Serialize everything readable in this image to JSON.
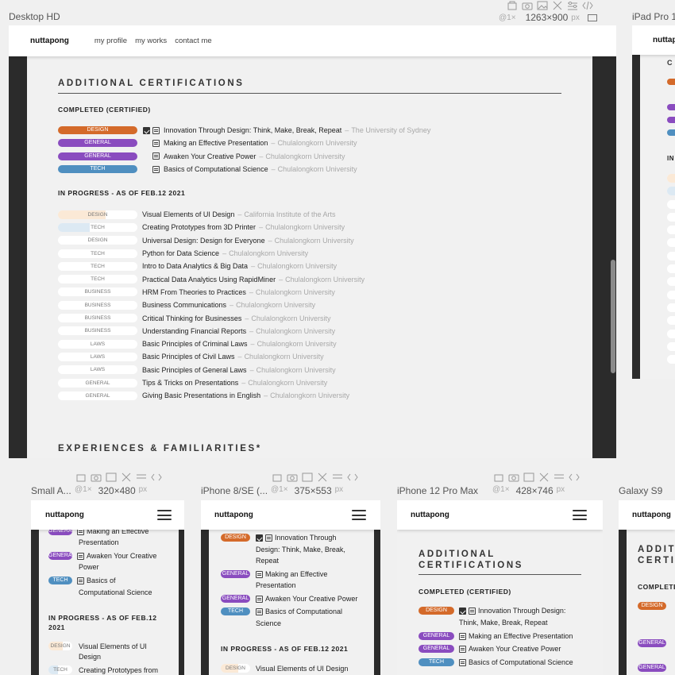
{
  "colors": {
    "design": "#d46a2a",
    "general": "#8a4cbf",
    "tech": "#4f8fc0"
  },
  "frames": {
    "desktop": {
      "title": "Desktop HD",
      "zoom": "@1×",
      "size": "1263×900",
      "unit": "px"
    },
    "ipad": {
      "title": "iPad Pro 1"
    },
    "small": {
      "title": "Small A...",
      "zoom": "@1×",
      "size": "320×480",
      "unit": "px"
    },
    "iphone8": {
      "title": "iPhone 8/SE (...",
      "zoom": "@1×",
      "size": "375×553",
      "unit": "px"
    },
    "iphone12": {
      "title": "iPhone 12 Pro Max",
      "zoom": "@1×",
      "size": "428×746",
      "unit": "px"
    },
    "galaxy": {
      "title": "Galaxy S9"
    }
  },
  "site": {
    "brand": "nuttapong",
    "nav": [
      "my profile",
      "my works",
      "contact me"
    ],
    "section_title": "ADDITIONAL CERTIFICATIONS",
    "section_title_l1": "ADDITIONAL",
    "section_title_l2": "CERTIFICATIONS",
    "section_title_cut": "ADDIT",
    "section_title_cut2": "CERTI",
    "completed_title": "COMPLETED (CERTIFIED)",
    "completed_cut": "COMPLETE",
    "in_progress_title": "IN PROGRESS - AS OF FEB.12 2021",
    "in_progress_l1": "IN PROGRESS - AS OF FEB.12",
    "in_progress_l2": "2021",
    "experiences_title": "EXPERIENCES & FAMILIARITIES*",
    "sep": "–",
    "completed": [
      {
        "tag": "DESIGN",
        "name": "Innovation Through Design: Think, Make, Break, Repeat",
        "org": "The University of Sydney"
      },
      {
        "tag": "GENERAL",
        "name": "Making an Effective Presentation",
        "org": "Chulalongkorn University"
      },
      {
        "tag": "GENERAL",
        "name": "Awaken Your Creative Power",
        "org": "Chulalongkorn University"
      },
      {
        "tag": "TECH",
        "name": "Basics of Computational Science",
        "org": "Chulalongkorn University"
      }
    ],
    "in_progress": [
      {
        "tag": "DESIGN",
        "name": "Visual Elements of UI Design",
        "org": "California Institute of the Arts",
        "progress": 0.6
      },
      {
        "tag": "TECH",
        "name": "Creating Prototypes from 3D Printer",
        "org": "Chulalongkorn University",
        "progress": 0.4
      },
      {
        "tag": "DESIGN",
        "name": "Universal Design: Design for Everyone",
        "org": "Chulalongkorn University",
        "progress": 0
      },
      {
        "tag": "TECH",
        "name": "Python for Data Science",
        "org": "Chulalongkorn University",
        "progress": 0
      },
      {
        "tag": "TECH",
        "name": "Intro to Data Analytics & Big Data",
        "org": "Chulalongkorn University",
        "progress": 0
      },
      {
        "tag": "TECH",
        "name": "Practical Data Analytics Using RapidMiner",
        "org": "Chulalongkorn University",
        "progress": 0
      },
      {
        "tag": "BUSINESS",
        "name": "HRM From Theories to Practices",
        "org": "Chulalongkorn University",
        "progress": 0
      },
      {
        "tag": "BUSINESS",
        "name": "Business Communications",
        "org": "Chulalongkorn University",
        "progress": 0
      },
      {
        "tag": "BUSINESS",
        "name": "Critical Thinking for Businesses",
        "org": "Chulalongkorn University",
        "progress": 0
      },
      {
        "tag": "BUSINESS",
        "name": "Understanding Financial Reports",
        "org": "Chulalongkorn University",
        "progress": 0
      },
      {
        "tag": "LAWS",
        "name": "Basic Principles of Criminal Laws",
        "org": "Chulalongkorn University",
        "progress": 0
      },
      {
        "tag": "LAWS",
        "name": "Basic Principles of Civil Laws",
        "org": "Chulalongkorn University",
        "progress": 0
      },
      {
        "tag": "LAWS",
        "name": "Basic Principles of General Laws",
        "org": "Chulalongkorn University",
        "progress": 0
      },
      {
        "tag": "GENERAL",
        "name": "Tips & Tricks on Presentations",
        "org": "Chulalongkorn University",
        "progress": 0
      },
      {
        "tag": "GENERAL",
        "name": "Giving Basic Presentations in English",
        "org": "Chulalongkorn University",
        "progress": 0
      }
    ],
    "small_lines": {
      "making1": "Making an Effective",
      "making2": "Presentation",
      "awaken1": "Awaken Your Creative",
      "awaken2": "Power",
      "basics1": "Basics of",
      "basics2": "Computational Science",
      "visual1": "Visual Elements of UI",
      "visual2": "Design",
      "creating1": "Creating Prototypes from"
    },
    "iphone8_lines": {
      "innov1": "Innovation Through",
      "innov2": "Design: Think, Make, Break,",
      "innov3": "Repeat",
      "making1": "Making an Effective",
      "making2": "Presentation",
      "awaken": "Awaken Your Creative Power",
      "basics1": "Basics of Computational",
      "basics2": "Science",
      "visual": "Visual Elements of UI Design"
    },
    "iphone12_lines": {
      "innov1": "Innovation Through Design:",
      "innov2": "Think, Make, Break, Repeat",
      "making": "Making an Effective Presentation",
      "awaken": "Awaken Your Creative Power",
      "basics": "Basics of Computational Science"
    }
  }
}
